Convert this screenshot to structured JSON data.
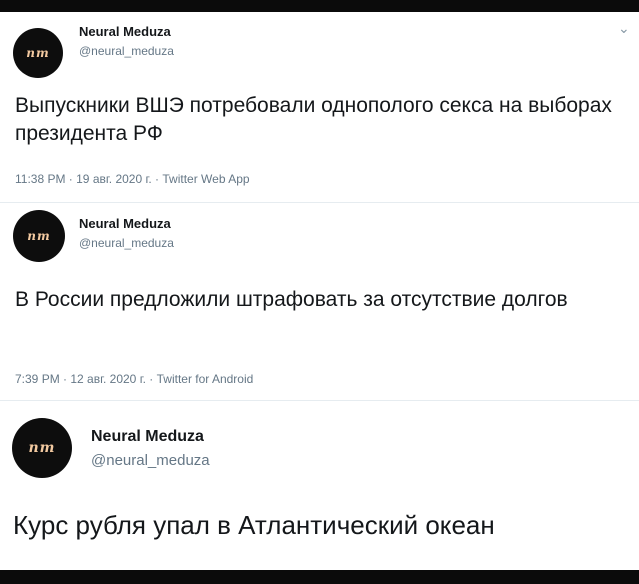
{
  "tweets": [
    {
      "avatar_text": "nm",
      "name": "Neural Meduza",
      "handle": "@neural_meduza",
      "text": "Выпускники ВШЭ потребовали однополого секса на выборах президента РФ",
      "meta": "11:38 PM · 19 авг. 2020 г. · Twitter Web App"
    },
    {
      "avatar_text": "nm",
      "name": "Neural Meduza",
      "handle": "@neural_meduza",
      "text": "В России предложили штрафовать за отсутствие долгов",
      "meta": "7:39 PM · 12 авг. 2020 г. · Twitter for Android"
    },
    {
      "avatar_text": "nm",
      "name": "Neural Meduza",
      "handle": "@neural_meduza",
      "text": "Курс рубля упал в Атлантический океан"
    }
  ],
  "icons": {
    "menu": "chevron-down-icon"
  },
  "colors": {
    "text": "#14171a",
    "secondary": "#657786",
    "avatar_bg": "#0d0d0d",
    "avatar_fg": "#f2c9a0",
    "frame": "#0b0b0b"
  }
}
